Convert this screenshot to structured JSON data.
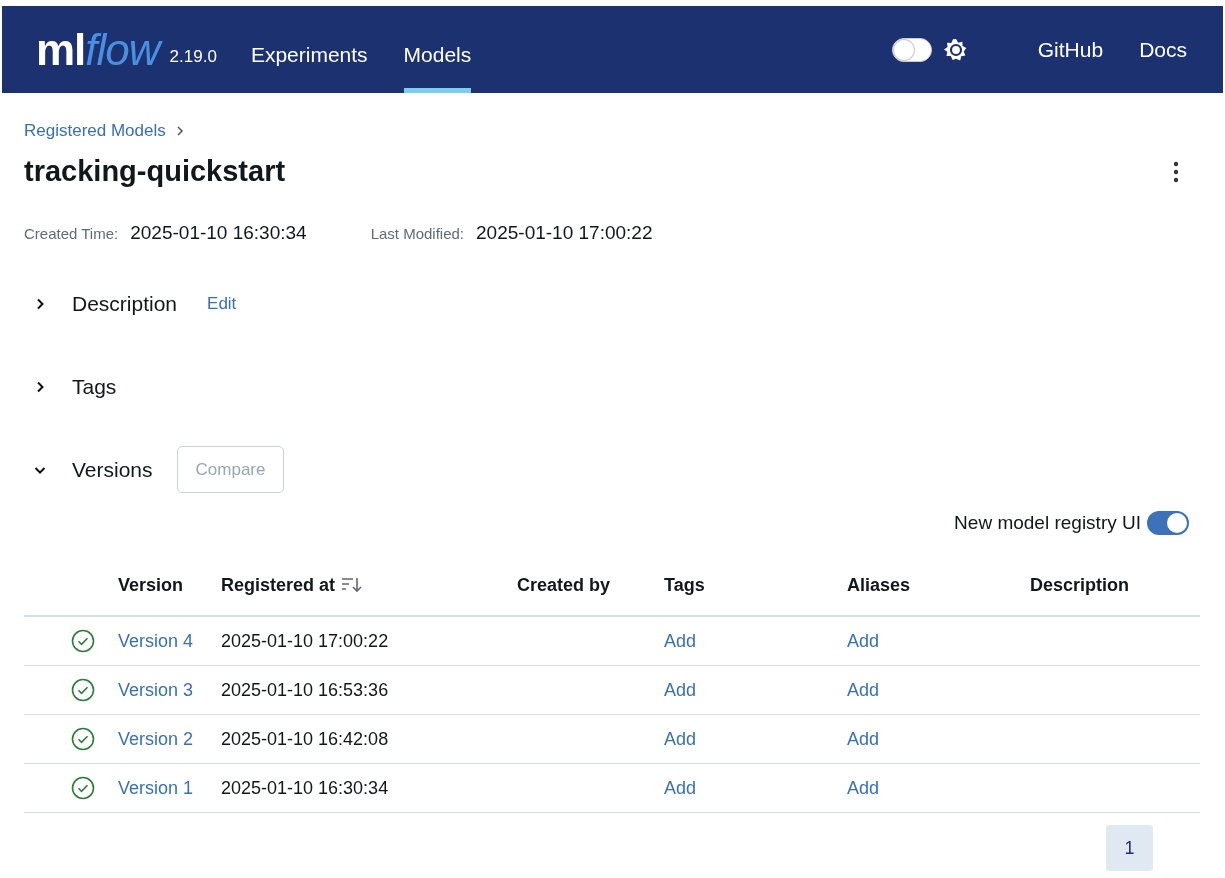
{
  "nav": {
    "logo": {
      "part_1": "ml",
      "part_2": "flow"
    },
    "version": "2.19.0",
    "tabs": [
      {
        "label": "Experiments",
        "selected": false
      },
      {
        "label": "Models",
        "selected": true
      }
    ],
    "dark_mode": {
      "on": false
    },
    "links": [
      "GitHub",
      "Docs"
    ]
  },
  "breadcrumb": "Registered Models",
  "title": "tracking-quickstart",
  "meta": [
    {
      "label": "Created Time:",
      "value": "2025-01-10 16:30:34"
    },
    {
      "label": "Last Modified:",
      "value": "2025-01-10 17:00:22"
    }
  ],
  "sections": [
    {
      "title": "Description",
      "expanded": false,
      "action": "Edit"
    },
    {
      "title": "Tags",
      "expanded": false
    },
    {
      "title": "Versions",
      "expanded": true,
      "button": {
        "label": "Compare",
        "disabled": true
      }
    }
  ],
  "registry_toggle": {
    "label": "New model registry UI",
    "on": true
  },
  "table": {
    "columns": [
      "Version",
      "Registered at",
      "Created by",
      "Tags",
      "Aliases",
      "Description"
    ],
    "rows": [
      {
        "version": "Version 4",
        "registered_at": "2025-01-10 17:00:22",
        "tags": "Add",
        "aliases": "Add"
      },
      {
        "version": "Version 3",
        "registered_at": "2025-01-10 16:53:36",
        "tags": "Add",
        "aliases": "Add"
      },
      {
        "version": "Version 2",
        "registered_at": "2025-01-10 16:42:08",
        "tags": "Add",
        "aliases": "Add"
      },
      {
        "version": "Version 1",
        "registered_at": "2025-01-10 16:30:34",
        "tags": "Add",
        "aliases": "Add"
      }
    ]
  },
  "pagination": [
    {
      "label": "1",
      "selected": true
    }
  ]
}
